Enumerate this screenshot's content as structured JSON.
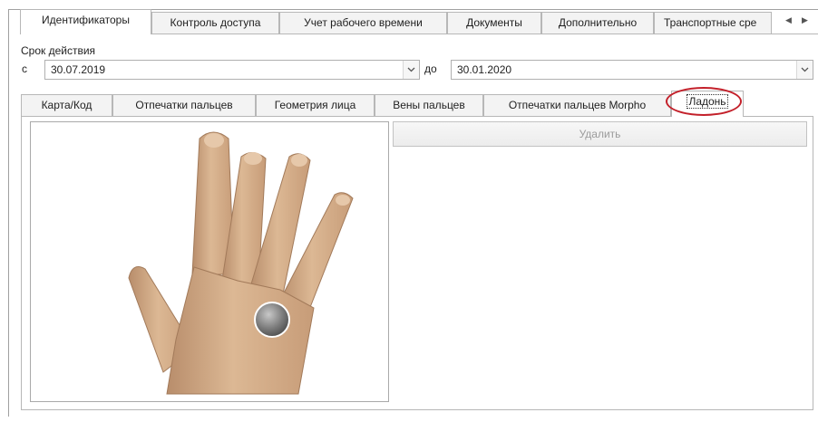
{
  "top_tabs": [
    "Идентификаторы",
    "Контроль доступа",
    "Учет рабочего времени",
    "Документы",
    "Дополнительно",
    "Транспортные сре"
  ],
  "validity": {
    "label": "Срок действия",
    "from_label": "с",
    "from_value": "30.07.2019",
    "to_label": "до",
    "to_value": "30.01.2020"
  },
  "inner_tabs": [
    "Карта/Код",
    "Отпечатки пальцев",
    "Геометрия лица",
    "Вены пальцев",
    "Отпечатки пальцев Morpho",
    "Ладонь"
  ],
  "delete_button": "Удалить",
  "colors": {
    "highlight_ring": "#c3202a",
    "skin": "#d8b08c"
  },
  "icons": [
    "scroll-left-icon",
    "scroll-right-icon",
    "chevron-down-icon",
    "hand-palm-illustration"
  ]
}
